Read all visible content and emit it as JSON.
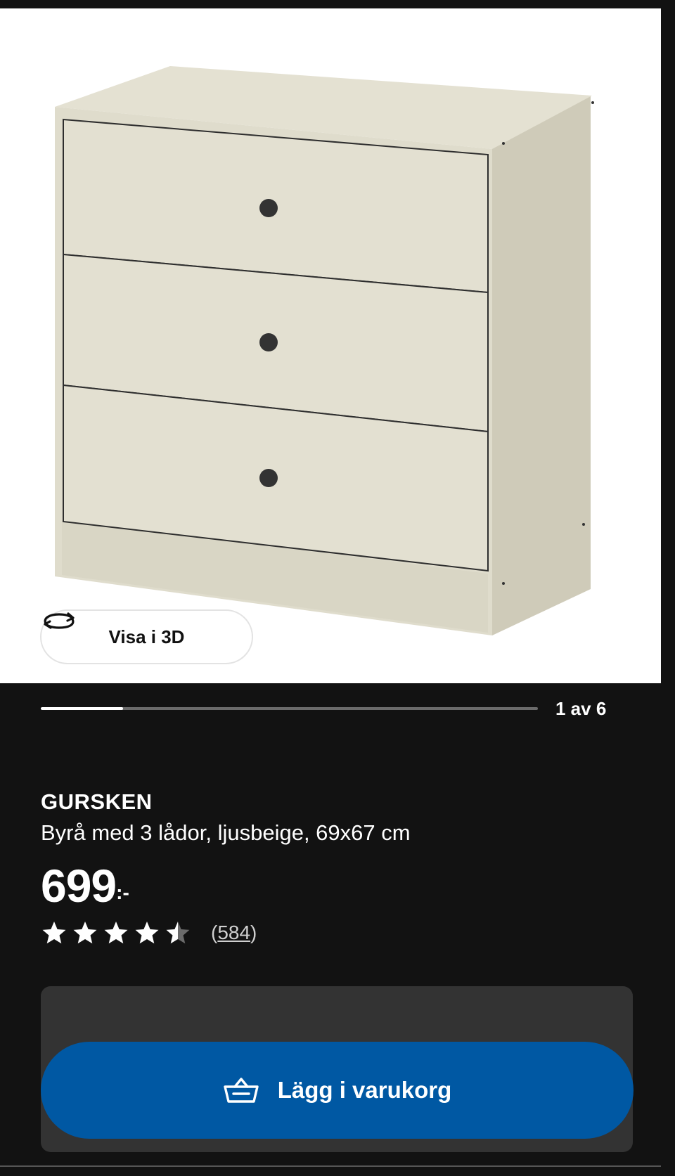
{
  "gallery": {
    "view_3d_label": "Visa i 3D",
    "counter": "1 av 6",
    "progress": 0.165
  },
  "product": {
    "name": "GURSKEN",
    "description": "Byrå med 3 lådor, ljusbeige, 69x67 cm",
    "price": "699",
    "price_suffix": ":-",
    "rating": 4.5,
    "rating_max": 5,
    "review_count": "584"
  },
  "actions": {
    "add_to_cart_label": "Lägg i varukorg"
  },
  "colors": {
    "background": "#121212",
    "primary_button": "#0058a3",
    "panel": "#333333",
    "product_beige": "#e2dfd0"
  },
  "icons": {
    "view_3d": "rotate-3d-icon",
    "cart": "shopping-basket-icon",
    "star": "star-icon"
  }
}
